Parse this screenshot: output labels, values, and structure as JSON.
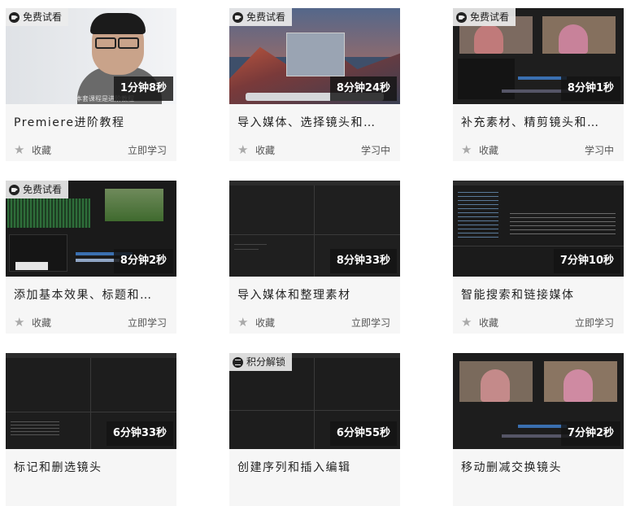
{
  "cards": [
    {
      "badge": "免费试看",
      "duration": "1分钟8秒",
      "title": "Premiere进阶教程",
      "favorite": "收藏",
      "action": "立即学习",
      "caption": "本套课程是进阶教程"
    },
    {
      "badge": "免费试看",
      "duration": "8分钟24秒",
      "title": "导入媒体、选择镜头和…",
      "favorite": "收藏",
      "action": "学习中"
    },
    {
      "badge": "免费试看",
      "duration": "8分钟1秒",
      "title": "补充素材、精剪镜头和…",
      "favorite": "收藏",
      "action": "学习中"
    },
    {
      "badge": "免费试看",
      "duration": "8分钟2秒",
      "title": "添加基本效果、标题和…",
      "favorite": "收藏",
      "action": "立即学习"
    },
    {
      "badge": "",
      "duration": "8分钟33秒",
      "title": "导入媒体和整理素材",
      "favorite": "收藏",
      "action": "立即学习"
    },
    {
      "badge": "",
      "duration": "7分钟10秒",
      "title": "智能搜索和链接媒体",
      "favorite": "收藏",
      "action": "立即学习"
    },
    {
      "badge": "",
      "duration": "6分钟33秒",
      "title": "标记和删选镜头",
      "favorite": "",
      "action": ""
    },
    {
      "badge": "积分解锁",
      "duration": "6分钟55秒",
      "title": "创建序列和插入编辑",
      "favorite": "",
      "action": ""
    },
    {
      "badge": "",
      "duration": "7分钟2秒",
      "title": "移动删减交换镜头",
      "favorite": "",
      "action": ""
    }
  ],
  "icons": {
    "badge_video": "video-camera-icon",
    "badge_unlock": "points-unlock-icon",
    "favorite": "star-icon"
  }
}
